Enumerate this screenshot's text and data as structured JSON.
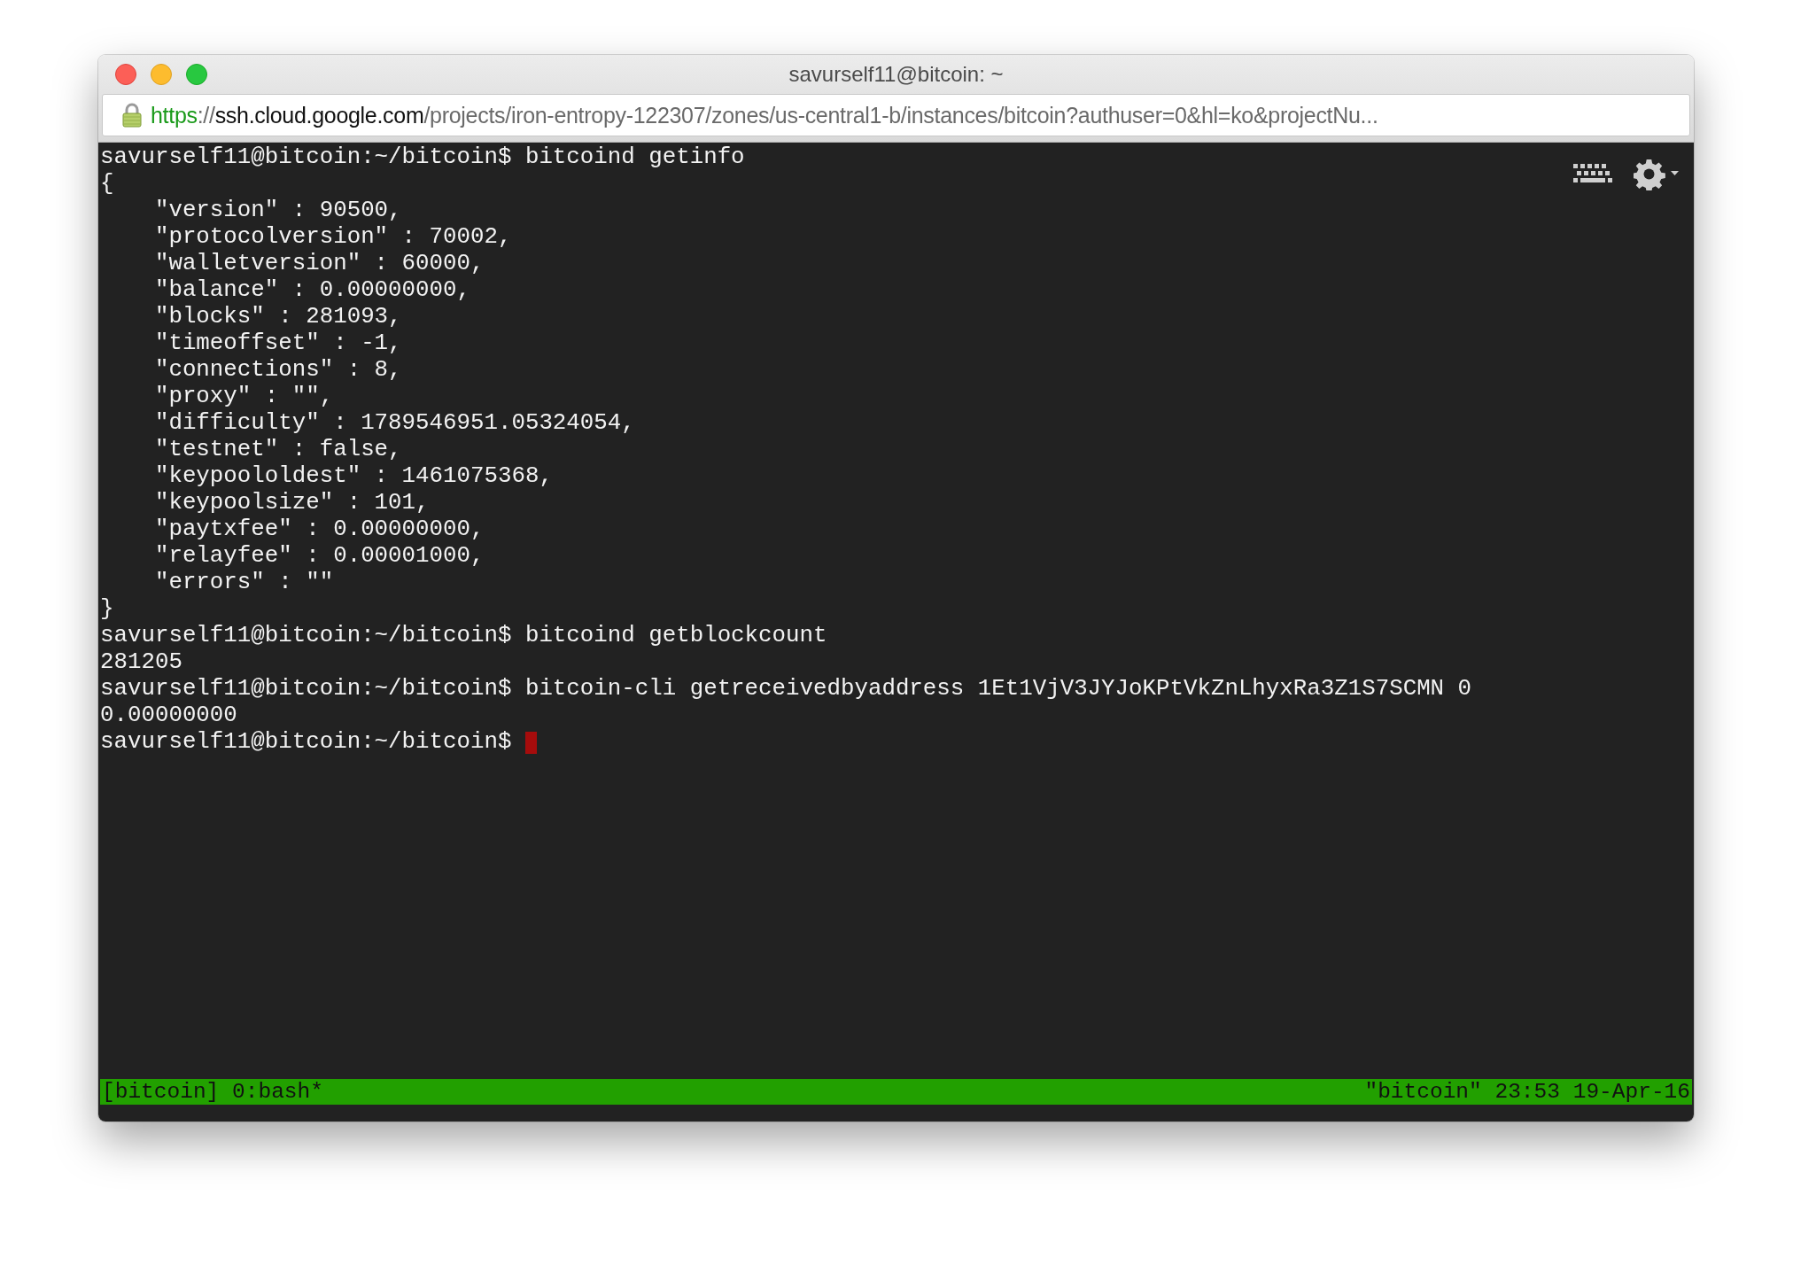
{
  "window": {
    "title": "savurself11@bitcoin: ~"
  },
  "address_bar": {
    "scheme": "https",
    "separator": "://",
    "host": "ssh.cloud.google.com",
    "path": "/projects/iron-entropy-122307/zones/us-central1-b/instances/bitcoin?authuser=0&hl=ko&projectNu..."
  },
  "terminal": {
    "lines": [
      "savurself11@bitcoin:~/bitcoin$ bitcoind getinfo",
      "{",
      "    \"version\" : 90500,",
      "    \"protocolversion\" : 70002,",
      "    \"walletversion\" : 60000,",
      "    \"balance\" : 0.00000000,",
      "    \"blocks\" : 281093,",
      "    \"timeoffset\" : -1,",
      "    \"connections\" : 8,",
      "    \"proxy\" : \"\",",
      "    \"difficulty\" : 1789546951.05324054,",
      "    \"testnet\" : false,",
      "    \"keypoololdest\" : 1461075368,",
      "    \"keypoolsize\" : 101,",
      "    \"paytxfee\" : 0.00000000,",
      "    \"relayfee\" : 0.00001000,",
      "    \"errors\" : \"\"",
      "}",
      "savurself11@bitcoin:~/bitcoin$ bitcoind getblockcount",
      "281205",
      "savurself11@bitcoin:~/bitcoin$ bitcoin-cli getreceivedbyaddress 1Et1VjV3JYJoKPtVkZnLhyxRa3Z1S7SCMN 0",
      "0.00000000",
      "savurself11@bitcoin:~/bitcoin$ "
    ],
    "cursor": {
      "visible": true
    }
  },
  "status_bar": {
    "left": "[bitcoin] 0:bash*",
    "right": "\"bitcoin\" 23:53 19-Apr-16"
  }
}
